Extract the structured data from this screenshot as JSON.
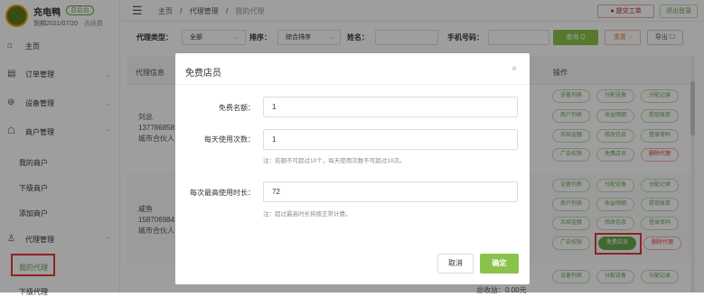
{
  "brand": {
    "name": "充电鸭",
    "tag": "总后台",
    "expire": "到期2021/07/20",
    "renew": "去续费"
  },
  "sidebar": {
    "home": "主页",
    "orders": "订单管理",
    "devices": "设备管理",
    "merchants": "商户管理",
    "merchant_sub": [
      "我的商户",
      "下级商户",
      "添加商户"
    ],
    "agents": "代理管理",
    "agent_sub": [
      "我的代理",
      "下级代理"
    ]
  },
  "topbar": {
    "crumbs": [
      "主页",
      "代理管理",
      "我的代理"
    ],
    "sep": "/",
    "ticket": "● 提交工单",
    "logout": "退出登录"
  },
  "filters": {
    "type_label": "代理类型：",
    "type_value": "全部",
    "sort_label": "排序：",
    "sort_value": "综合排序",
    "name_label": "姓名：",
    "phone_label": "手机号码：",
    "search": "查询 Q",
    "reset": "重置 ○",
    "export": "导出 ☐"
  },
  "table": {
    "headers": {
      "info": "代理信息",
      "ops": "操作"
    },
    "rows": [
      {
        "name": "刘总",
        "phone": "1377868581",
        "role": "城市合伙人"
      },
      {
        "name": "咸鱼",
        "phone": "1587069841",
        "role": "城市合伙人"
      }
    ],
    "ops": [
      [
        "设备列表",
        "分配设备",
        "分配记录"
      ],
      [
        "商户列表",
        "收益明细",
        "提现账单"
      ],
      [
        "冻结金额",
        "修改信息",
        "登录密码"
      ],
      [
        "广告权限",
        "免费店员",
        "删除代理"
      ]
    ],
    "bottom": "总收益：0.00元"
  },
  "modal": {
    "title": "免费店员",
    "close": "×",
    "fields": [
      {
        "label": "免费名额：",
        "value": "1",
        "note": ""
      },
      {
        "label": "每天使用次数：",
        "value": "1",
        "note": "注：名额不可超过10个，每天使用次数不可超过10次。"
      },
      {
        "label": "每次最高使用时长：",
        "value": "72",
        "note": "注：超过最高时长将按正常计费。"
      }
    ],
    "cancel": "取消",
    "confirm": "确定"
  },
  "colors": {
    "accent": "#8bc34a",
    "danger": "#e53935"
  }
}
